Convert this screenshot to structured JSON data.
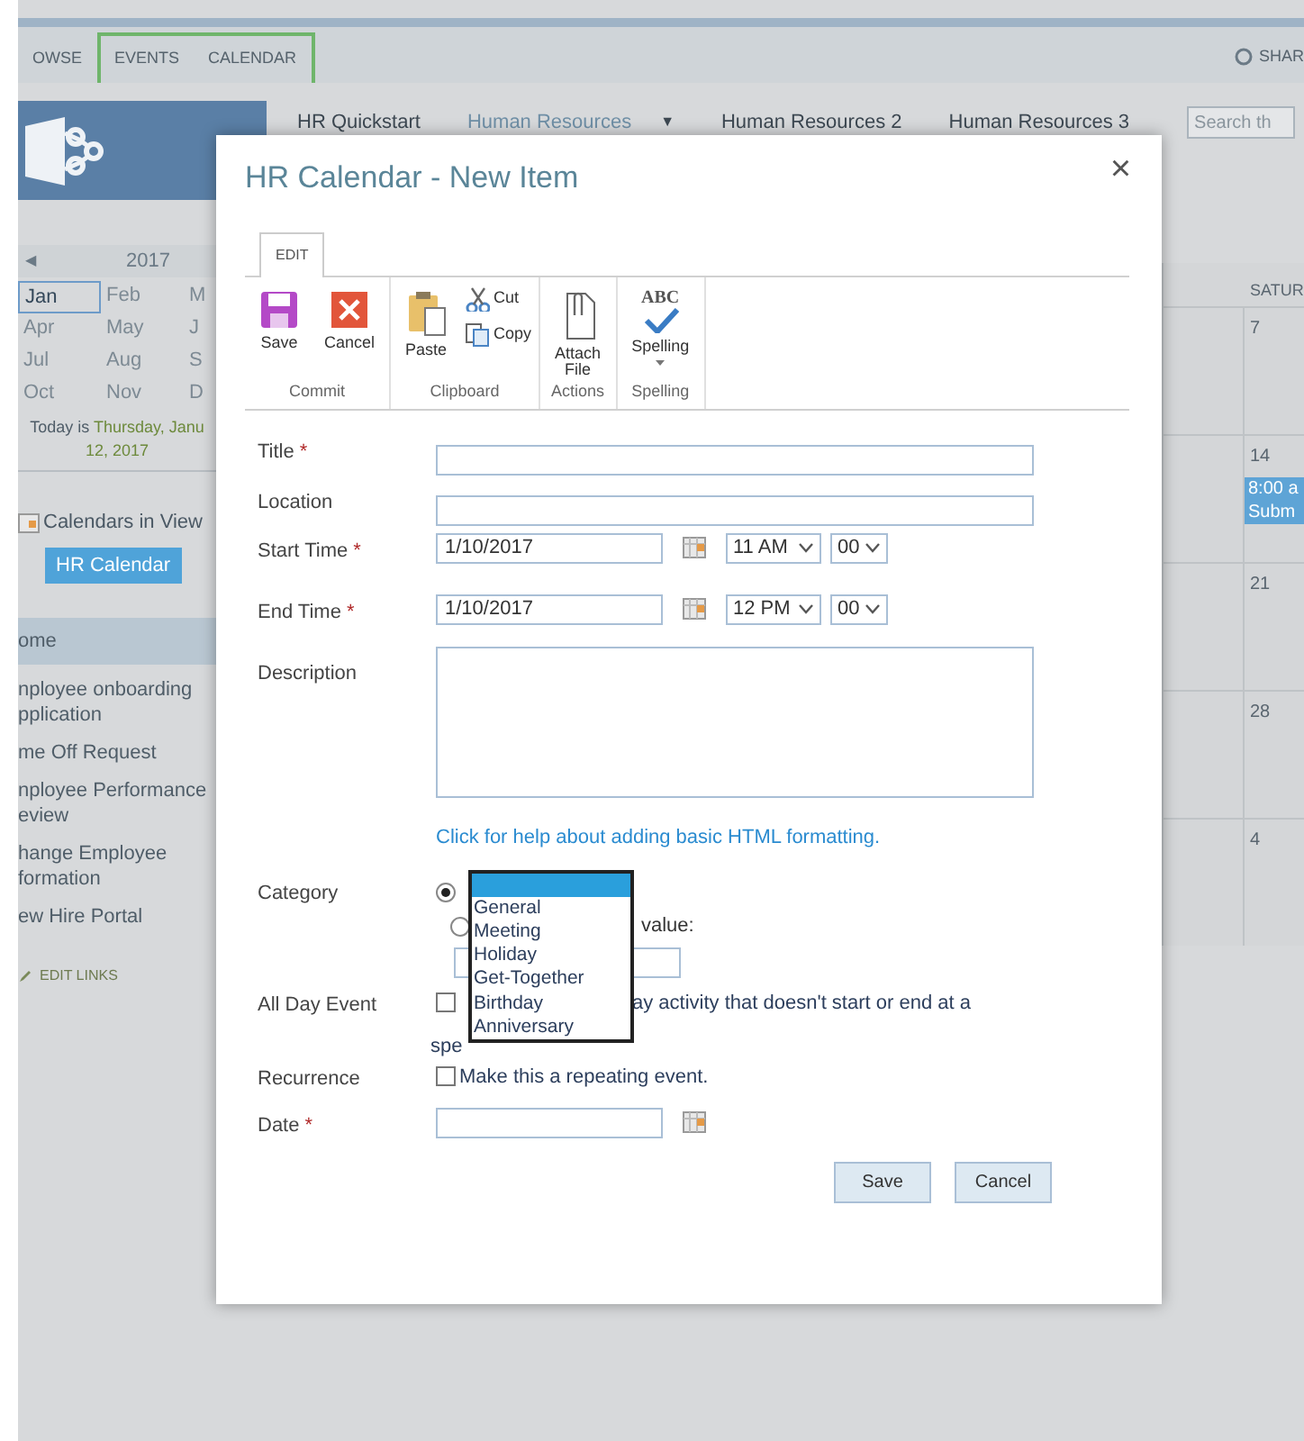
{
  "top_tabs": [
    {
      "label": "OWSE",
      "contextual": false
    },
    {
      "label": "EVENTS",
      "contextual": true
    },
    {
      "label": "CALENDAR",
      "contextual": true
    }
  ],
  "share": "SHAR",
  "nav_links": [
    {
      "label": "HR Quickstart",
      "selected": false
    },
    {
      "label": "Human Resources",
      "selected": true,
      "menu_glyph": "▼"
    },
    {
      "label": "Human Resources 2",
      "selected": false
    },
    {
      "label": "Human Resources 3",
      "selected": false
    }
  ],
  "search": {
    "placeholder": "Search th"
  },
  "date_picker": {
    "prev": "◀",
    "year": "2017",
    "months": [
      {
        "label": "Jan",
        "selected": true
      },
      {
        "label": "Feb",
        "selected": false
      },
      {
        "label": "M",
        "selected": false
      },
      {
        "label": "Apr",
        "selected": false
      },
      {
        "label": "May",
        "selected": false
      },
      {
        "label": "J",
        "selected": false
      },
      {
        "label": "Jul",
        "selected": false
      },
      {
        "label": "Aug",
        "selected": false
      },
      {
        "label": "S",
        "selected": false
      },
      {
        "label": "Oct",
        "selected": false
      },
      {
        "label": "Nov",
        "selected": false
      },
      {
        "label": "D",
        "selected": false
      }
    ],
    "today_prefix": "Today is",
    "today_date": "Thursday, Janu",
    "today_date_line2": "12, 2017"
  },
  "calendars_in_view": {
    "label": "Calendars in View",
    "chips": [
      "HR Calendar"
    ]
  },
  "quick_launch": [
    {
      "lines": [
        "ome"
      ],
      "selected": true
    },
    {
      "lines": [
        "nployee onboarding",
        "pplication"
      ],
      "selected": false
    },
    {
      "lines": [
        "me Off Request"
      ],
      "selected": false
    },
    {
      "lines": [
        "nployee Performance",
        "eview"
      ],
      "selected": false
    },
    {
      "lines": [
        "hange Employee",
        "formation"
      ],
      "selected": false
    },
    {
      "lines": [
        "ew Hire Portal"
      ],
      "selected": false
    }
  ],
  "edit_links": "EDIT LINKS",
  "calendar": {
    "day_header": "SATUR",
    "days": [
      {
        "date": "7"
      },
      {
        "date": "14",
        "events": [
          {
            "time": "8:00 a",
            "title": "Subm"
          }
        ]
      },
      {
        "date": "21"
      },
      {
        "date": "28"
      },
      {
        "date": "4"
      }
    ]
  },
  "dialog": {
    "title": "HR Calendar - New Item",
    "close": "×",
    "ribbon": {
      "tabs": [
        {
          "label": "EDIT",
          "selected": true
        }
      ],
      "groups": [
        {
          "label": "Commit",
          "items": [
            {
              "kind": "save",
              "label": "Save"
            },
            {
              "kind": "cancel",
              "label": "Cancel"
            }
          ]
        },
        {
          "label": "Clipboard",
          "items": [
            {
              "kind": "paste",
              "label": "Paste"
            },
            {
              "kind": "cut",
              "label": "Cut"
            },
            {
              "kind": "copy",
              "label": "Copy"
            }
          ]
        },
        {
          "label": "Actions",
          "items": [
            {
              "kind": "attach",
              "label": "Attach File"
            }
          ]
        },
        {
          "label": "Spelling",
          "items": [
            {
              "kind": "spelling",
              "label": "Spelling",
              "icon_text": "ABC"
            }
          ]
        }
      ]
    },
    "fields": [
      {
        "kind": "text",
        "label": "Title",
        "required_mark": "*"
      },
      {
        "kind": "text",
        "label": "Location"
      },
      {
        "kind": "datetime",
        "label": "Start Time",
        "required_mark": "*",
        "value": "1/10/2017",
        "hour": "11 AM",
        "minute": "00"
      },
      {
        "kind": "datetime",
        "label": "End Time",
        "required_mark": "*",
        "value": "1/10/2017",
        "hour": "12 PM",
        "minute": "00"
      },
      {
        "kind": "textarea",
        "label": "Description",
        "help_link": "Click for help about adding basic HTML formatting."
      },
      {
        "kind": "choice",
        "label": "Category",
        "options": [
          {
            "selected": true
          },
          {
            "selected": false,
            "text": "value:"
          }
        ],
        "listbox": [
          {
            "selected": true
          },
          {
            "label": "General",
            "selected": false
          },
          {
            "label": "Meeting",
            "selected": false
          },
          {
            "label": "Holiday",
            "selected": false
          },
          {
            "label": "Get-Together",
            "selected": false
          },
          {
            "label": "Birthday",
            "selected": false
          },
          {
            "label": "Anniversary",
            "selected": false
          }
        ]
      },
      {
        "kind": "checkbox",
        "label": "All Day Event",
        "checked": false,
        "text": "ay activity that doesn't start or end at a",
        "text_line2": "spe"
      },
      {
        "kind": "checkbox",
        "label": "Recurrence",
        "checked": false,
        "text": "Make this a repeating event."
      },
      {
        "kind": "date",
        "label": "Date",
        "required_mark": "*"
      }
    ],
    "buttons": [
      "Save",
      "Cancel"
    ]
  }
}
